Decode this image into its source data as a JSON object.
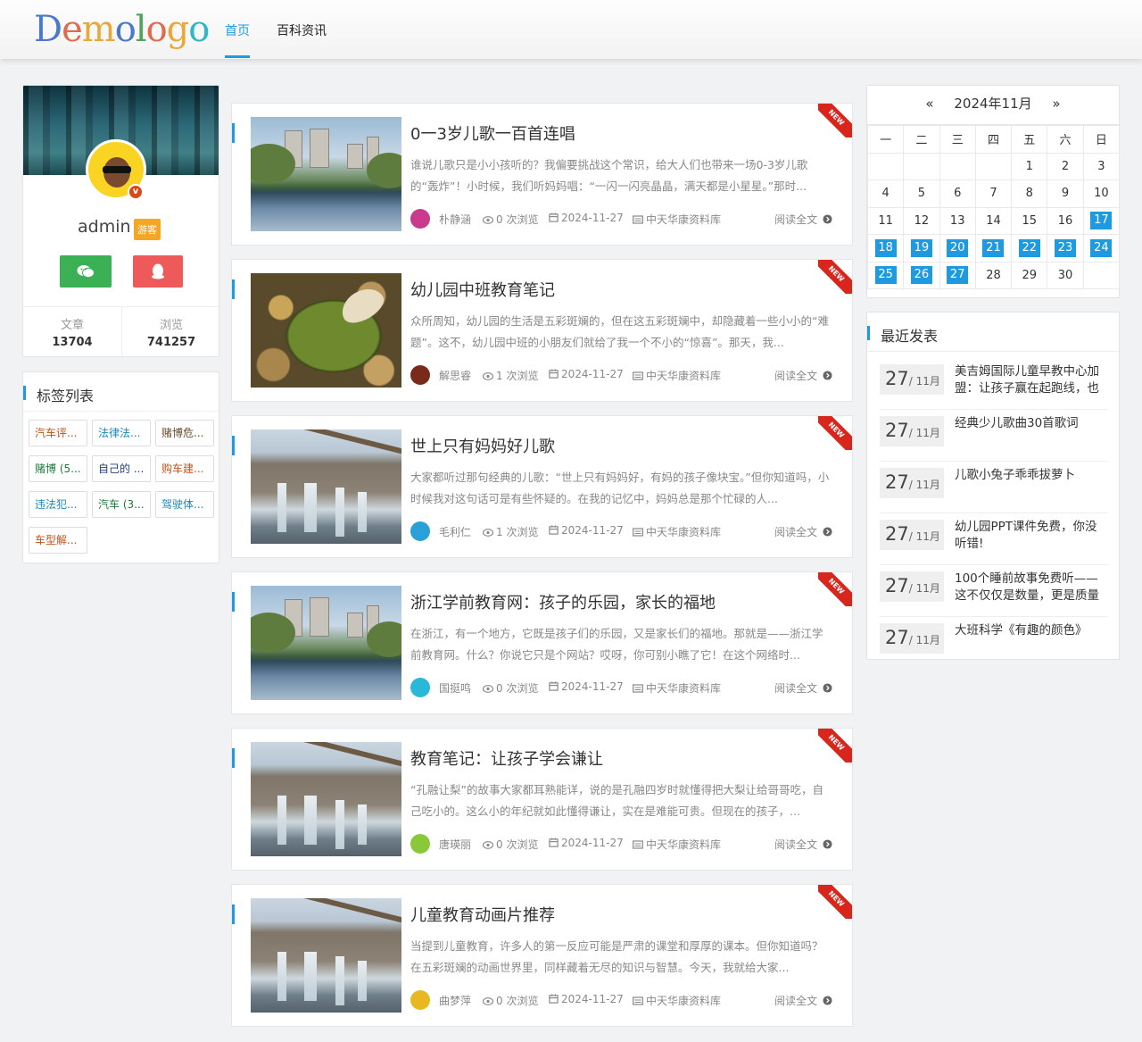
{
  "logo_text": [
    "D",
    "e",
    "m",
    "o",
    "l",
    "o",
    "g",
    "o"
  ],
  "nav": [
    {
      "label": "首页",
      "active": true
    },
    {
      "label": "百科资讯",
      "active": false
    }
  ],
  "profile": {
    "name": "admin",
    "role": "游客",
    "stats": [
      {
        "label": "文章",
        "value": "13704"
      },
      {
        "label": "浏览",
        "value": "741257"
      }
    ]
  },
  "tags": {
    "title": "标签列表",
    "items": [
      {
        "label": "汽车评...",
        "color": "#c0531d"
      },
      {
        "label": "法律法...",
        "color": "#1e88b8"
      },
      {
        "label": "赌博危...",
        "color": "#6b4a2a"
      },
      {
        "label": "赌博 (5...",
        "color": "#1e7a3a"
      },
      {
        "label": "自己的 ...",
        "color": "#1e3f7a"
      },
      {
        "label": "购车建...",
        "color": "#c0531d"
      },
      {
        "label": "违法犯...",
        "color": "#1e88b8"
      },
      {
        "label": "汽车 (3...",
        "color": "#1e7a3a"
      },
      {
        "label": "驾驶体...",
        "color": "#1e88b8"
      },
      {
        "label": "车型解...",
        "color": "#c0531d"
      }
    ]
  },
  "articles": [
    {
      "title": "0一3岁儿歌一百首连唱",
      "desc": "谁说儿歌只是小小孩听的？我偏要挑战这个常识，给大人们也带来一场0-3岁儿歌的“轰炸”！小时候，我们听妈妈唱：“一闪一闪亮晶晶，满天都是小星星。”那时...",
      "author": "朴静涵",
      "views": "0 次浏览",
      "date": "2024-11-27",
      "source": "中天华康资料库",
      "more": "阅读全文",
      "ribbon": "NEW",
      "scene": "city",
      "avatar_color": "#c73a8c"
    },
    {
      "title": "幼儿园中班教育笔记",
      "desc": "众所周知，幼儿园的生活是五彩斑斓的，但在这五彩斑斓中，却隐藏着一些小小的“难题”。这不，幼儿园中班的小朋友们就给了我一个不小的“惊喜”。那天，我...",
      "author": "解思睿",
      "views": "1 次浏览",
      "date": "2024-11-27",
      "source": "中天华康资料库",
      "more": "阅读全文",
      "ribbon": "NEW",
      "scene": "leaf",
      "avatar_color": "#7a2a1a"
    },
    {
      "title": "世上只有妈妈好儿歌",
      "desc": "大家都听过那句经典的儿歌：“世上只有妈妈好，有妈的孩子像块宝。”但你知道吗，小时候我对这句话可是有些怀疑的。在我的记忆中，妈妈总是那个忙碌的人...",
      "author": "毛利仁",
      "views": "1 次浏览",
      "date": "2024-11-27",
      "source": "中天华康资料库",
      "more": "阅读全文",
      "ribbon": "NEW",
      "scene": "falls",
      "avatar_color": "#2aa0d8"
    },
    {
      "title": "浙江学前教育网：孩子的乐园，家长的福地",
      "desc": "在浙江，有一个地方，它既是孩子们的乐园，又是家长们的福地。那就是——浙江学前教育网。什么？你说它只是个网站？哎呀，你可别小瞧了它！在这个网络时...",
      "author": "国挺鸣",
      "views": "0 次浏览",
      "date": "2024-11-27",
      "source": "中天华康资料库",
      "more": "阅读全文",
      "ribbon": "NEW",
      "scene": "city",
      "avatar_color": "#2ab8d8"
    },
    {
      "title": "教育笔记：让孩子学会谦让",
      "desc": "“孔融让梨”的故事大家都耳熟能详，说的是孔融四岁时就懂得把大梨让给哥哥吃，自己吃小的。这么小的年纪就如此懂得谦让，实在是难能可贵。但现在的孩子，...",
      "author": "唐瑛丽",
      "views": "0 次浏览",
      "date": "2024-11-27",
      "source": "中天华康资料库",
      "more": "阅读全文",
      "ribbon": "NEW",
      "scene": "falls",
      "avatar_color": "#8ac83a"
    },
    {
      "title": "儿童教育动画片推荐",
      "desc": "当提到儿童教育，许多人的第一反应可能是严肃的课堂和厚厚的课本。但你知道吗？在五彩斑斓的动画世界里，同样藏着无尽的知识与智慧。今天，我就给大家...",
      "author": "曲梦萍",
      "views": "0 次浏览",
      "date": "2024-11-27",
      "source": "中天华康资料库",
      "more": "阅读全文",
      "ribbon": "NEW",
      "scene": "falls",
      "avatar_color": "#e8b820"
    }
  ],
  "calendar": {
    "prev": "«",
    "title": "2024年11月",
    "next": "»",
    "weekdays": [
      "一",
      "二",
      "三",
      "四",
      "五",
      "六",
      "日"
    ],
    "weeks": [
      [
        "",
        "",
        "",
        "",
        "1",
        "2",
        "3"
      ],
      [
        "4",
        "5",
        "6",
        "7",
        "8",
        "9",
        "10"
      ],
      [
        "11",
        "12",
        "13",
        "14",
        "15",
        "16",
        "17"
      ],
      [
        "18",
        "19",
        "20",
        "21",
        "22",
        "23",
        "24"
      ],
      [
        "25",
        "26",
        "27",
        "28",
        "29",
        "30",
        ""
      ]
    ],
    "highlighted": [
      "17",
      "18",
      "19",
      "20",
      "21",
      "22",
      "23",
      "24",
      "25",
      "26",
      "27"
    ]
  },
  "recent": {
    "title": "最近发表",
    "items": [
      {
        "day": "27",
        "month": "/ 11月",
        "title": "美吉姆国际儿童早教中心加盟：让孩子赢在起跑线，也"
      },
      {
        "day": "27",
        "month": "/ 11月",
        "title": "经典少儿歌曲30首歌词"
      },
      {
        "day": "27",
        "month": "/ 11月",
        "title": "儿歌小兔子乖乖拔萝卜"
      },
      {
        "day": "27",
        "month": "/ 11月",
        "title": "幼儿园PPT课件免费，你没听错!"
      },
      {
        "day": "27",
        "month": "/ 11月",
        "title": "100个睡前故事免费听——这不仅仅是数量，更是质量"
      },
      {
        "day": "27",
        "month": "/ 11月",
        "title": "大班科学《有趣的颜色》"
      }
    ]
  },
  "colors": {
    "accent": "#1e9be0",
    "ribbon": "#d9261c",
    "wechat": "#3cb054",
    "qq": "#ee5a5a",
    "role": "#f5a623"
  }
}
